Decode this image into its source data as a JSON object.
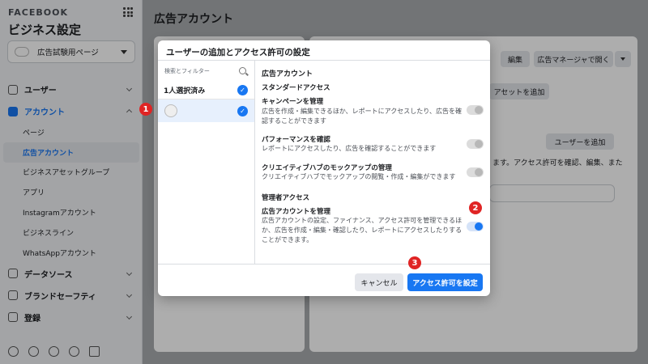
{
  "sidebar": {
    "brand": "FACEBOOK",
    "title": "ビジネス設定",
    "page_select": "広告試験用ページ",
    "groups": {
      "users": "ユーザー",
      "accounts": "アカウント",
      "data_sources": "データソース",
      "brand_safety": "ブランドセーフティ",
      "registration": "登録"
    },
    "account_items": [
      "ページ",
      "広告アカウント",
      "ビジネスアセットグループ",
      "アプリ",
      "Instagramアカウント",
      "ビジネスライン",
      "WhatsAppアカウント"
    ]
  },
  "main": {
    "title": "広告アカウント",
    "edit_button": "編集",
    "open_ads_manager_button": "広告マネージャで開く",
    "add_asset_button": "アセットを追加",
    "add_user_button": "ユーザーを追加",
    "partial_text": "ます。アクセス許可を確認、編集、また"
  },
  "modal": {
    "title": "ユーザーの追加とアクセス許可の設定",
    "search_placeholder": "検索とフィルター",
    "selected_count": "1人選択済み",
    "section_ad_account": "広告アカウント",
    "section_standard": "スタンダードアクセス",
    "section_admin": "管理者アクセス",
    "permissions": [
      {
        "title": "キャンペーンを管理",
        "desc": "広告を作成・編集できるほか、レポートにアクセスしたり、広告を確認することができます",
        "enabled": false
      },
      {
        "title": "パフォーマンスを確認",
        "desc": "レポートにアクセスしたり、広告を確認することができます",
        "enabled": false
      },
      {
        "title": "クリエイティブハブのモックアップの管理",
        "desc": "クリエイティブハブでモックアップの閲覧・作成・編集ができます",
        "enabled": false
      },
      {
        "title": "広告アカウントを管理",
        "desc": "広告アカウントの設定、ファイナンス、アクセス許可を管理できるほか、広告を作成・編集・確認したり、レポートにアクセスしたりすることができます。",
        "enabled": true
      }
    ],
    "cancel": "キャンセル",
    "confirm": "アクセス許可を設定"
  },
  "badges": [
    "1",
    "2",
    "3"
  ],
  "colors": {
    "accent": "#1877f2",
    "badge": "#e02424"
  }
}
